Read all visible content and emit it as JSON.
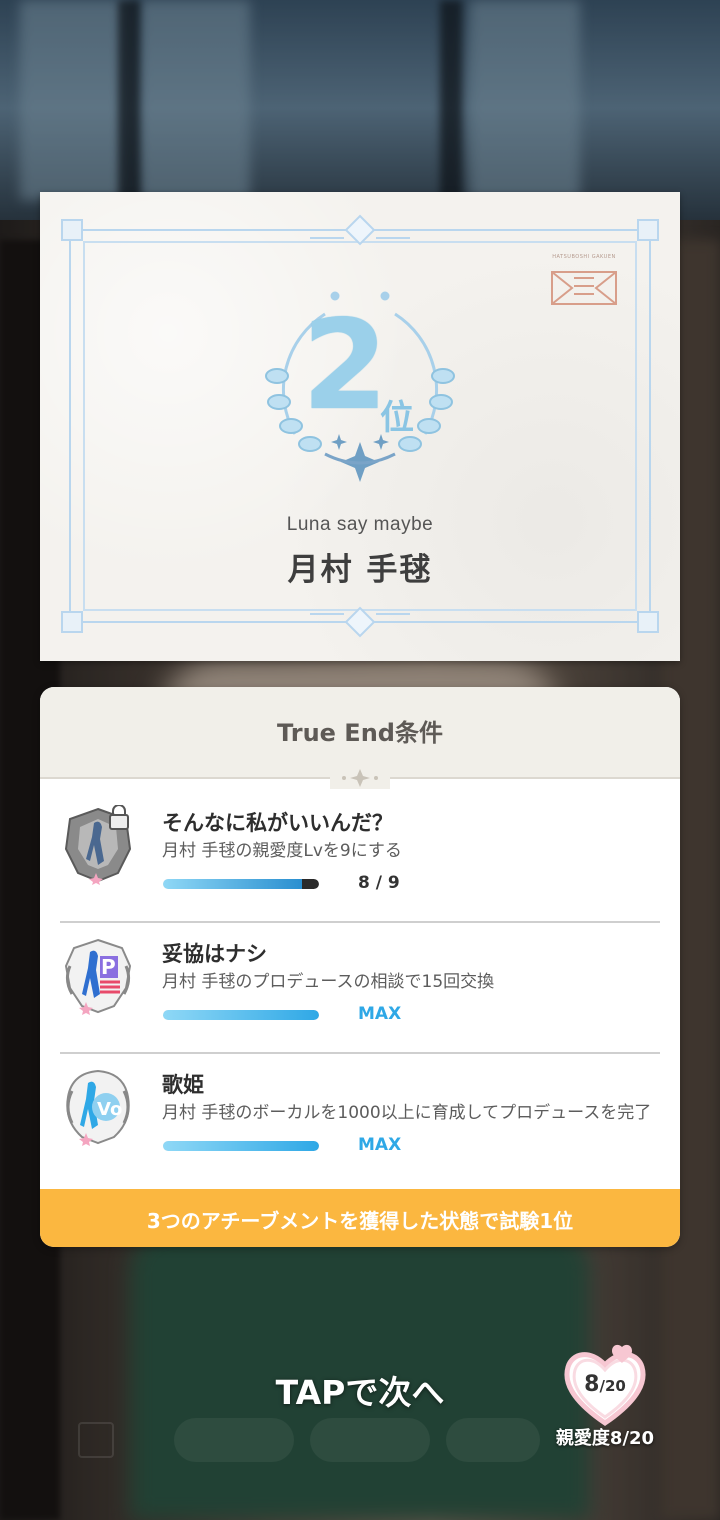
{
  "rank_card": {
    "rank_number": "2",
    "rank_suffix": "位",
    "unit_name": "Luna say maybe",
    "idol_name": "月村 手毬",
    "school_stamp_text": "HATSUBOSHI GAKUEN"
  },
  "true_end": {
    "title": "True End条件",
    "achievements": [
      {
        "title": "そんなに私がいいんだ？",
        "description": "月村 手毬の親愛度Lvを9にする",
        "progress_label": "8 / 9",
        "progress_fraction": 0.889,
        "locked": true,
        "badge_icon": "locked-silhouette-badge-icon"
      },
      {
        "title": "妥協はナシ",
        "description": "月村 手毬のプロデュースの相談で15回交換",
        "progress_label": "MAX",
        "progress_fraction": 1.0,
        "locked": false,
        "badge_icon": "produce-badge-icon"
      },
      {
        "title": "歌姫",
        "description": "月村 手毬のボーカルを1000以上に育成してプロデュースを完了",
        "progress_label": "MAX",
        "progress_fraction": 1.0,
        "locked": false,
        "badge_icon": "vocal-badge-icon"
      }
    ],
    "condition_text": "3つのアチーブメントを獲得した状態で試験1位"
  },
  "footer": {
    "tap_next": "TAPで次へ",
    "affinity_current": "8",
    "affinity_max": "/20",
    "affinity_caption": "親愛度8/20"
  },
  "colors": {
    "accent_blue": "#2fa8e6",
    "condition_orange": "#fbb740",
    "rank_blue": "#9bd0ea",
    "heart_pink": "#f7c7d2"
  }
}
